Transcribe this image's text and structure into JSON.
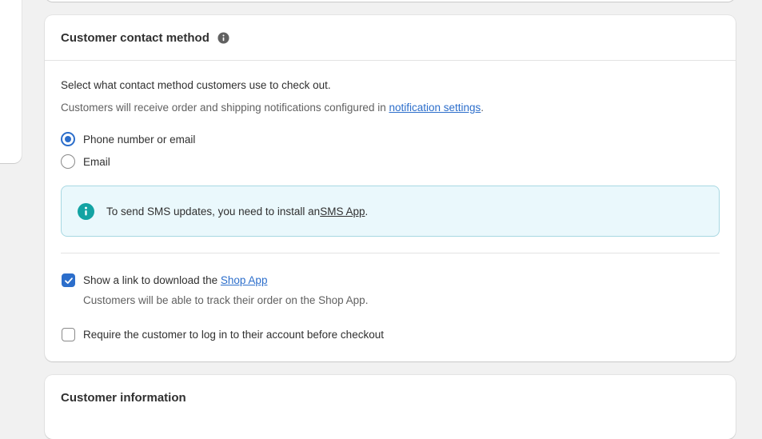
{
  "contact_method": {
    "title": "Customer contact method",
    "info_icon": "info-circle-icon",
    "description": "Select what contact method customers use to check out.",
    "notification_text": "Customers will receive order and shipping notifications configured in ",
    "notification_link": "notification settings",
    "notification_end": ".",
    "options": [
      {
        "label": "Phone number or email",
        "selected": true
      },
      {
        "label": "Email",
        "selected": false
      }
    ],
    "banner": {
      "icon": "info-circle-icon",
      "text": "To send SMS updates, you need to install an ",
      "link": "SMS App",
      "end": ".",
      "bg_color": "#eaf8fc",
      "icon_color": "#13a3a3"
    },
    "shop_app": {
      "label": "Show a link to download the ",
      "link": "Shop App",
      "checked": true,
      "helper": "Customers will be able to track their order on the Shop App."
    },
    "require_login": {
      "label": "Require the customer to log in to their account before checkout",
      "checked": false
    }
  },
  "customer_information": {
    "title": "Customer information"
  },
  "colors": {
    "accent": "#2c6ecb",
    "background": "#f1f1f1"
  }
}
